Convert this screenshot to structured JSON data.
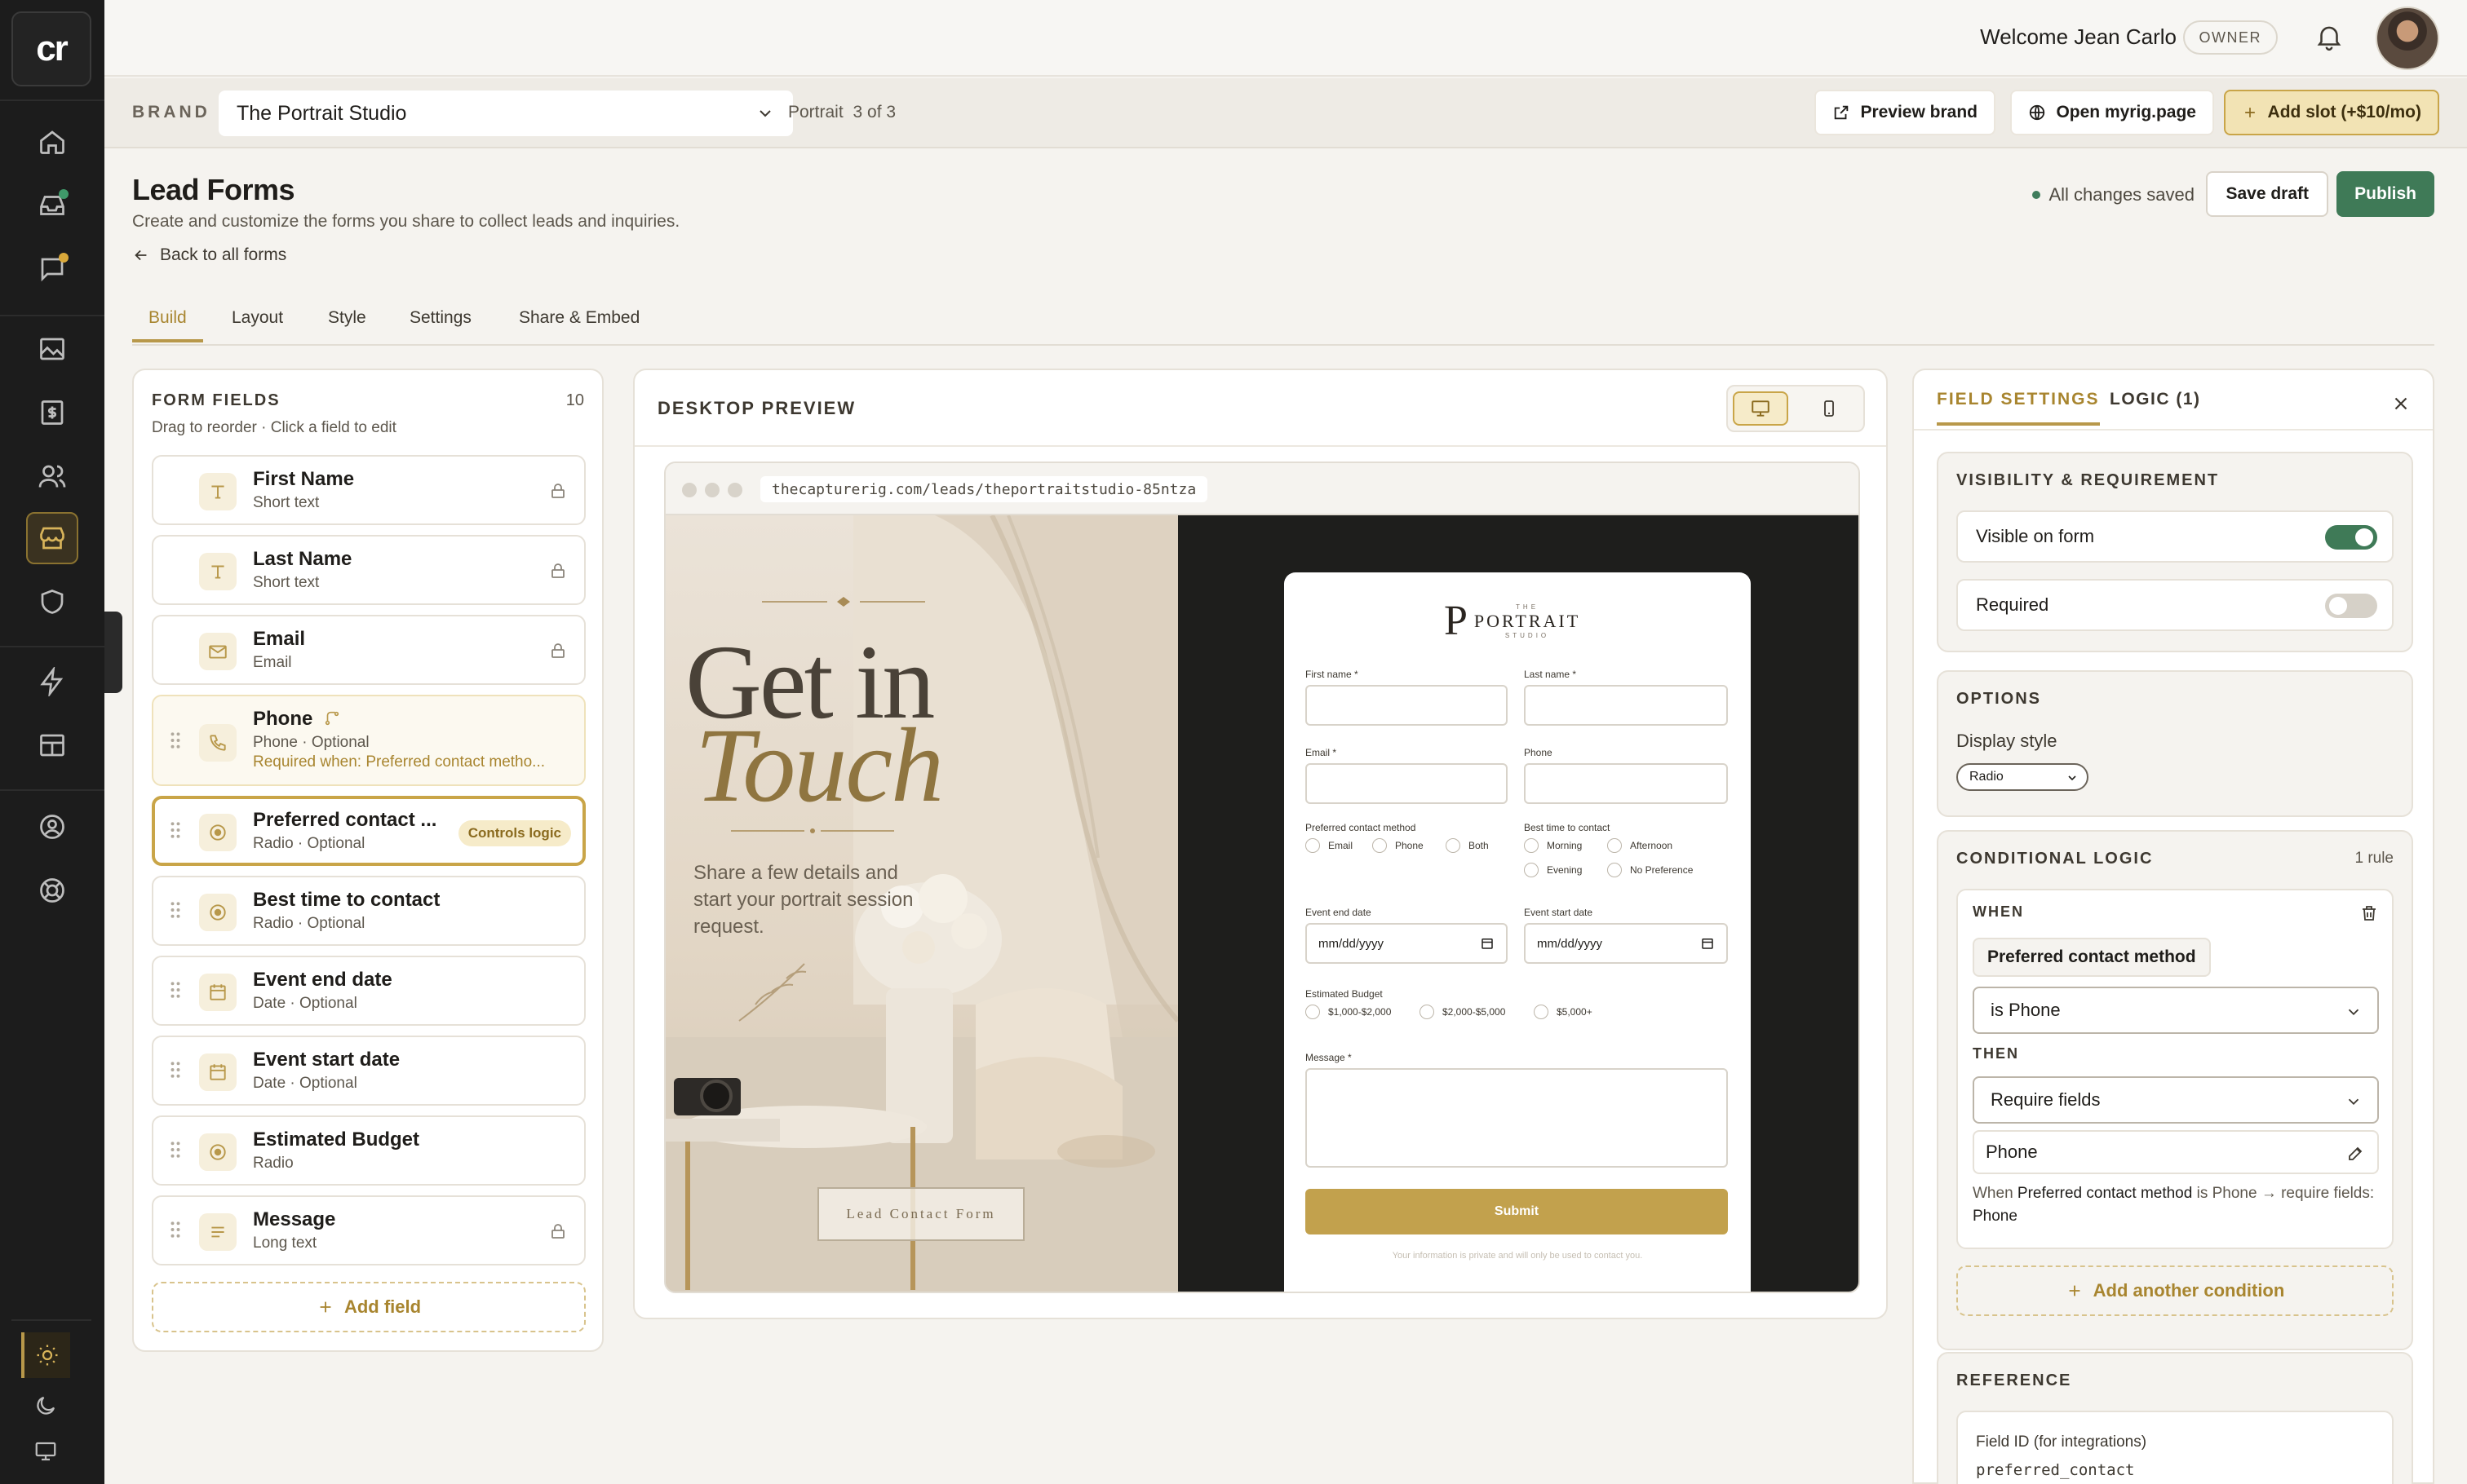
{
  "app": {
    "logo_text": "cr",
    "accent_color": "#b8984a",
    "success_color": "#3f7a57"
  },
  "sidebar": {
    "icons": [
      "home-icon",
      "inbox-icon",
      "chat-icon",
      "gallery-icon",
      "billing-icon",
      "clients-icon",
      "storefront-icon",
      "shield-icon",
      "bolt-icon",
      "layout-icon",
      "account-icon",
      "support-icon"
    ],
    "active": "storefront-icon",
    "theme_modes": [
      "light-mode-icon",
      "dark-mode-icon",
      "system-mode-icon"
    ],
    "active_theme": "light-mode-icon"
  },
  "topbar": {
    "welcome": "Welcome Jean Carlo",
    "role_badge": "OWNER"
  },
  "brandbar": {
    "label": "BRAND",
    "selected_brand": "The Portrait Studio",
    "portrait_label": "Portrait",
    "portrait_count": "3 of 3",
    "preview_brand": "Preview brand",
    "open_page": "Open myrig.page",
    "add_slot": "Add slot (+$10/mo)"
  },
  "header": {
    "title": "Lead Forms",
    "subtitle": "Create and customize the forms you share to collect leads and inquiries.",
    "back_link": "Back to all forms",
    "save_status": "All changes saved",
    "save_draft": "Save draft",
    "publish": "Publish"
  },
  "tabs": [
    "Build",
    "Layout",
    "Style",
    "Settings",
    "Share & Embed"
  ],
  "active_tab": "Build",
  "form_fields": {
    "title": "FORM FIELDS",
    "count": "10",
    "hint": "Drag to reorder · Click a field to edit",
    "add_field": "Add field",
    "items": [
      {
        "name": "First Name",
        "meta": "Short text",
        "icon": "text-icon",
        "locked": true
      },
      {
        "name": "Last Name",
        "meta": "Short text",
        "icon": "text-icon",
        "locked": true
      },
      {
        "name": "Email",
        "meta": "Email",
        "icon": "mail-icon",
        "locked": true
      },
      {
        "name": "Phone",
        "meta": "Phone · Optional",
        "icon": "phone-icon",
        "note": "Required when: Preferred contact metho..."
      },
      {
        "name": "Preferred contact ...",
        "meta": "Radio · Optional",
        "icon": "radio-icon",
        "badge": "Controls logic"
      },
      {
        "name": "Best time to contact",
        "meta": "Radio · Optional",
        "icon": "radio-icon"
      },
      {
        "name": "Event end date",
        "meta": "Date · Optional",
        "icon": "calendar-icon"
      },
      {
        "name": "Event start date",
        "meta": "Date · Optional",
        "icon": "calendar-icon"
      },
      {
        "name": "Estimated Budget",
        "meta": "Radio",
        "icon": "radio-icon"
      },
      {
        "name": "Message",
        "meta": "Long text",
        "icon": "paragraph-icon",
        "locked": true
      }
    ]
  },
  "preview": {
    "title": "DESKTOP PREVIEW",
    "url": "thecapturerig.com/leads/theportraitstudio-85ntza",
    "hero_line1": "Get in",
    "hero_line2": "Touch",
    "hero_text": "Share a few details and start your portrait session request.",
    "hero_badge": "Lead Contact Form",
    "brand_mark": "P",
    "brand_word": "PORTRAIT",
    "brand_top": "THE",
    "brand_sub": "STUDIO",
    "labels": {
      "first_name": "First name *",
      "last_name": "Last name *",
      "email": "Email *",
      "phone": "Phone",
      "preferred": "Preferred contact method",
      "best_time": "Best time to contact",
      "event_end": "Event end date",
      "event_start": "Event start date",
      "budget": "Estimated Budget",
      "message": "Message *"
    },
    "preferred_options": [
      "Email",
      "Phone",
      "Both"
    ],
    "best_time_options": [
      "Morning",
      "Afternoon",
      "Evening",
      "No Preference"
    ],
    "budget_options": [
      "$1,000-$2,000",
      "$2,000-$5,000",
      "$5,000+"
    ],
    "date_placeholder": "mm/dd/yyyy",
    "submit": "Submit",
    "privacy": "Your information is private and will only be used to contact you."
  },
  "settings": {
    "tab_field": "FIELD SETTINGS",
    "tab_logic": "LOGIC (1)",
    "visibility_title": "VISIBILITY & REQUIREMENT",
    "visible_label": "Visible on form",
    "visible_on": true,
    "required_label": "Required",
    "required_on": false,
    "options_title": "OPTIONS",
    "display_style_label": "Display style",
    "display_style_value": "Radio",
    "logic_title": "CONDITIONAL LOGIC",
    "rule_count": "1 rule",
    "when_label": "WHEN",
    "when_field": "Preferred contact method",
    "condition": "is Phone",
    "then_label": "THEN",
    "action": "Require fields",
    "target_field": "Phone",
    "summary_prefix": "When",
    "summary_field": "Preferred contact method",
    "summary_middle": "is Phone → require fields:",
    "summary_target": "Phone",
    "add_condition": "Add another condition",
    "reference_title": "REFERENCE",
    "field_id_label": "Field ID (for integrations)",
    "field_id_value": "preferred_contact"
  }
}
